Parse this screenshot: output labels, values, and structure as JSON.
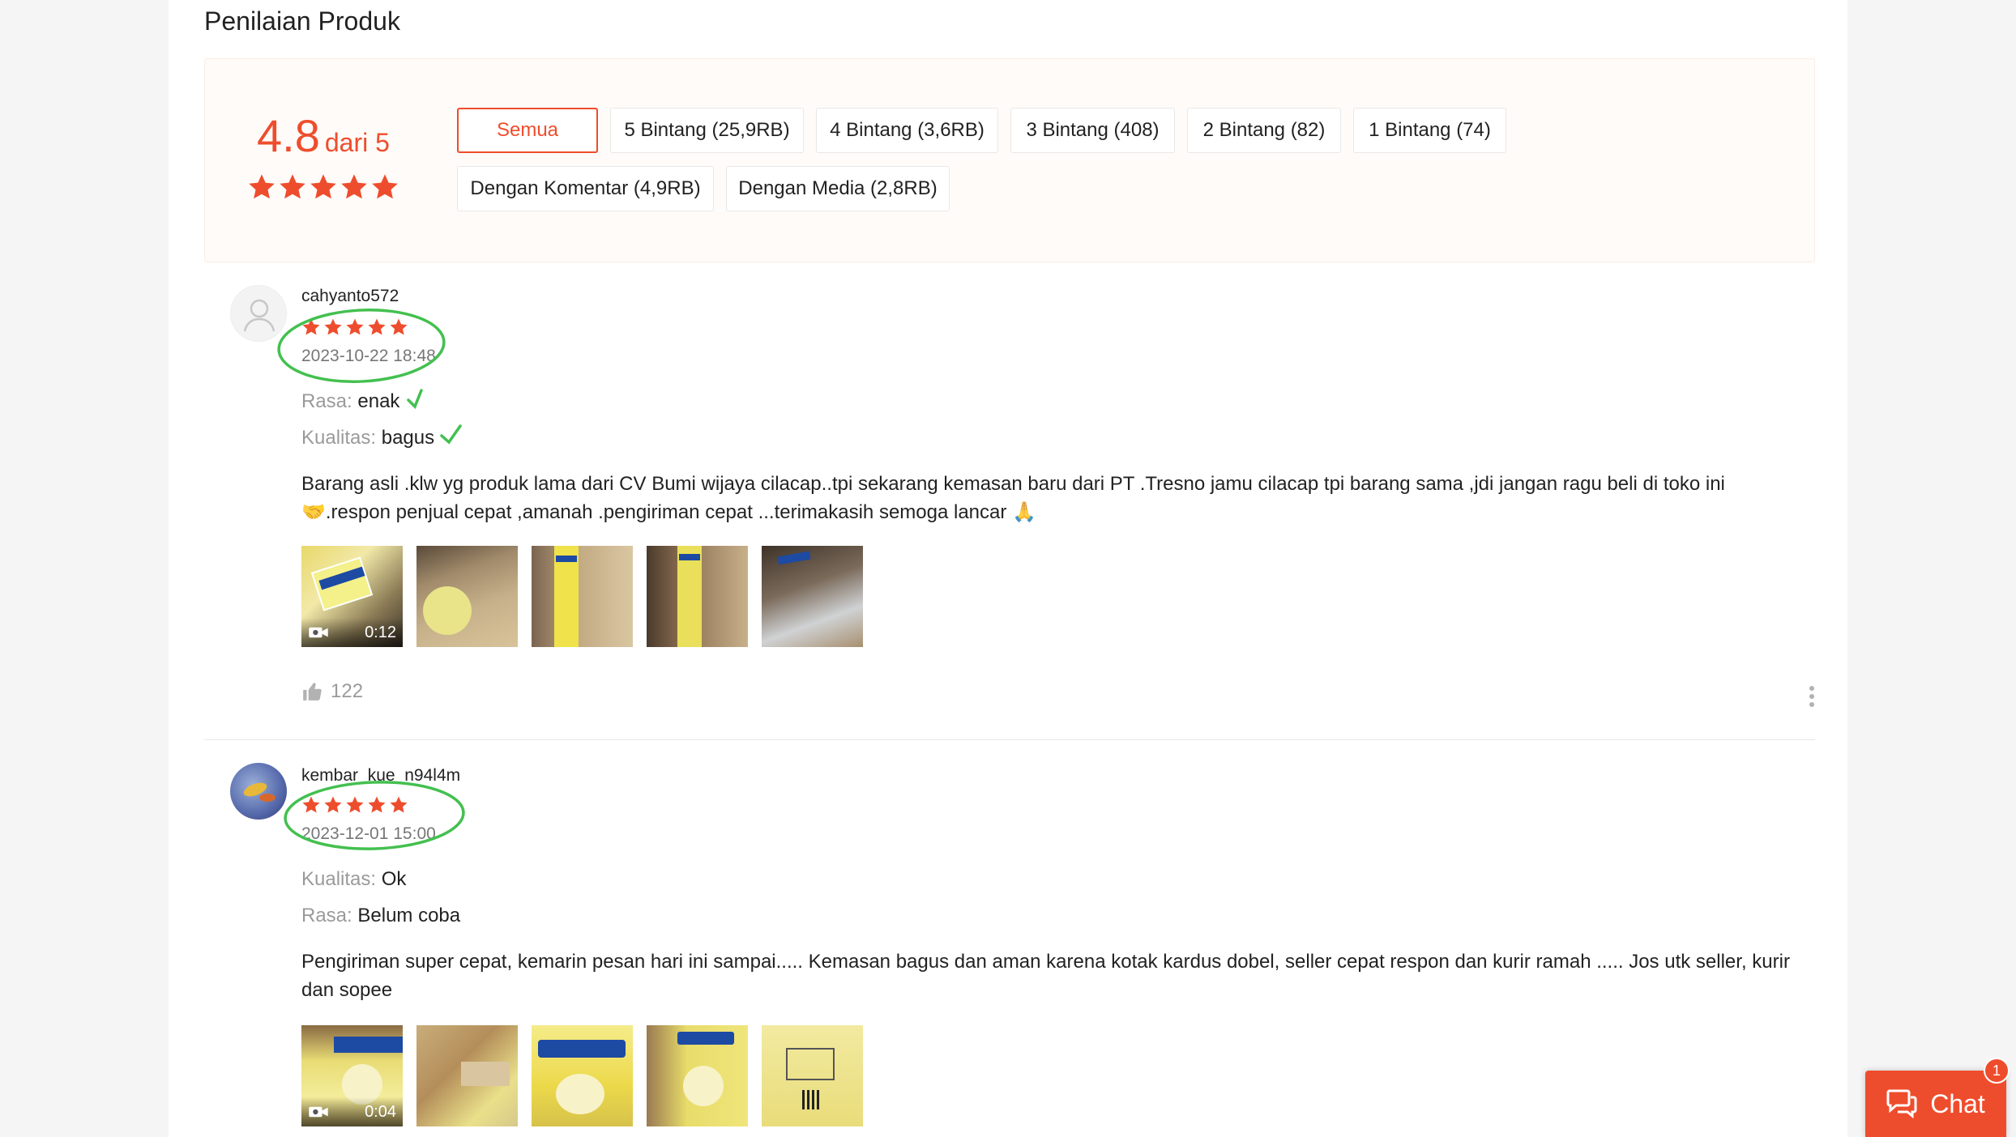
{
  "section_title": "Penilaian Produk",
  "overview": {
    "score": "4.8",
    "score_suffix": "dari 5",
    "rating": 4.8,
    "filters": [
      "Semua",
      "5 Bintang (25,9RB)",
      "4 Bintang (3,6RB)",
      "3 Bintang (408)",
      "2 Bintang (82)",
      "1 Bintang (74)",
      "Dengan Komentar (4,9RB)",
      "Dengan Media (2,8RB)"
    ],
    "active_filter": "Semua"
  },
  "reviews": [
    {
      "username": "cahyanto572",
      "stars": 5,
      "date": "2023-10-22 18:48",
      "attrs": [
        {
          "key": "Rasa:",
          "value": "enak"
        },
        {
          "key": "Kualitas:",
          "value": "bagus"
        }
      ],
      "comment_line1": "Barang asli .klw yg produk lama dari CV Bumi wijaya cilacap..tpi sekarang kemasan baru dari PT .Tresno jamu cilacap tpi barang sama ,jdi jangan ragu beli di toko ini",
      "comment_line2": "🤝.respon penjual cepat ,amanah .pengiriman cepat ...terimakasih semoga lancar 🙏",
      "video_duration": "0:12",
      "likes": "122"
    },
    {
      "username": "kembar_kue_n94l4m",
      "stars": 5,
      "date": "2023-12-01 15:00",
      "attrs": [
        {
          "key": "Kualitas:",
          "value": "Ok"
        },
        {
          "key": "Rasa:",
          "value": "Belum coba"
        }
      ],
      "comment_line1": "Pengiriman super cepat, kemarin pesan hari ini sampai..... Kemasan bagus dan aman karena kotak kardus dobel, seller cepat respon dan kurir ramah ..... Jos utk seller, kurir",
      "comment_line2": "dan sopee",
      "video_duration": "0:04"
    }
  ],
  "chat": {
    "label": "Chat",
    "badge": "1"
  },
  "colors": {
    "accent": "#ee4d2d",
    "annotation": "#43c04f"
  }
}
